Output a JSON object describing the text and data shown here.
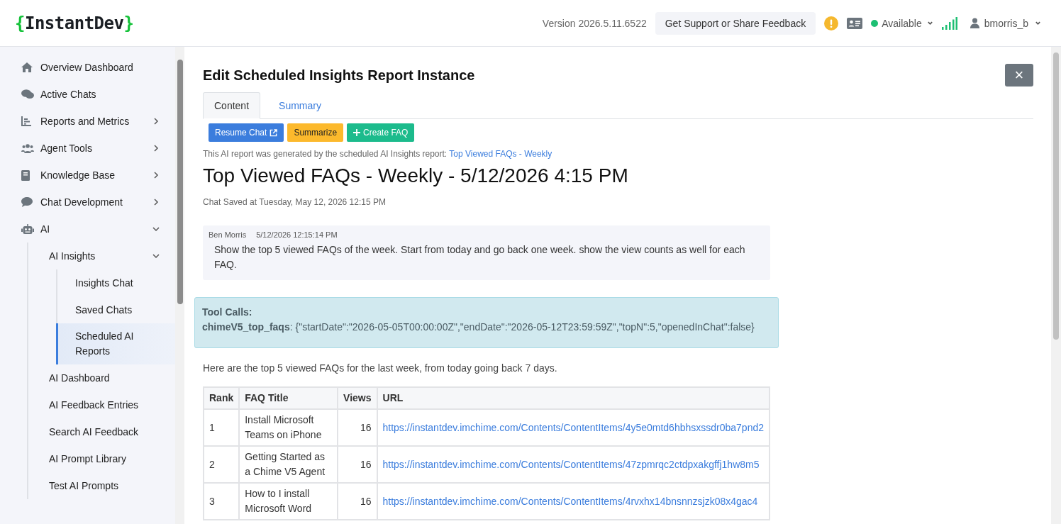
{
  "header": {
    "logo": {
      "open": "{",
      "name": "InstantDev",
      "close": "}"
    },
    "version": "Version 2026.5.11.6522",
    "support_button": "Get Support or Share Feedback",
    "status": "Available",
    "user": "bmorris_b"
  },
  "sidebar": {
    "items": [
      {
        "label": "Overview Dashboard",
        "selected": false
      },
      {
        "label": "Active Chats",
        "selected": false
      },
      {
        "label": "Reports and Metrics",
        "selected": false,
        "expanded": false
      },
      {
        "label": "Agent Tools",
        "selected": false,
        "expanded": false
      },
      {
        "label": "Knowledge Base",
        "selected": false,
        "expanded": false
      },
      {
        "label": "Chat Development",
        "selected": false,
        "expanded": false
      },
      {
        "label": "AI",
        "selected": false,
        "expanded": true,
        "children": [
          {
            "label": "AI Insights",
            "selected": false,
            "expanded": true,
            "children": [
              {
                "label": "Insights Chat",
                "selected": false
              },
              {
                "label": "Saved Chats",
                "selected": false
              },
              {
                "label": "Scheduled AI Reports",
                "selected": true
              }
            ]
          },
          {
            "label": "AI Dashboard",
            "selected": false
          },
          {
            "label": "AI Feedback Entries",
            "selected": false
          },
          {
            "label": "Search AI Feedback",
            "selected": false
          },
          {
            "label": "AI Prompt Library",
            "selected": false
          },
          {
            "label": "Test AI Prompts",
            "selected": false
          }
        ]
      }
    ]
  },
  "dialog": {
    "title": "Edit Scheduled Insights Report Instance",
    "close": "×",
    "tabs": [
      {
        "label": "Content",
        "selected": true
      },
      {
        "label": "Summary",
        "selected": false
      }
    ],
    "actions": [
      {
        "label": "Resume Chat",
        "kind": "primary"
      },
      {
        "label": "Summarize",
        "kind": "warning"
      },
      {
        "label": "Create FAQ",
        "kind": "success"
      }
    ],
    "source_note": {
      "text": "This AI report was generated by the scheduled AI Insights report:",
      "link": "Top Viewed FAQs - Weekly"
    },
    "report_title": "Top Viewed FAQs - Weekly - 5/12/2026 4:15 PM",
    "saved_at": "Chat Saved at Tuesday, May 12, 2026 12:15 PM",
    "message": {
      "author": "Ben Morris",
      "time": "5/12/2026 12:15:14 PM",
      "text": "Show the top 5 viewed FAQs of the week. Start from today and go back one week. show the view counts as well for each FAQ."
    },
    "tool_calls": {
      "heading": "Tool Calls:",
      "name": "chimeV5_top_faqs",
      "args": ": {\"startDate\":\"2026-05-05T00:00:00Z\",\"endDate\":\"2026-05-12T23:59:59Z\",\"topN\":5,\"openedInChat\":false}"
    },
    "answer_intro": "Here are the top 5 viewed FAQs for the last week, from today going back 7 days.",
    "table": {
      "columns": [
        "Rank",
        "FAQ Title",
        "Views",
        "URL"
      ],
      "rows": [
        [
          "1",
          "Install Microsoft Teams on iPhone",
          "16",
          "https://instantdev.imchime.com/Contents/ContentItems/4y5e0mtd6hbhsxssdr0ba7pnd2"
        ],
        [
          "2",
          "Getting Started as a Chime V5 Agent",
          "16",
          "https://instantdev.imchime.com/Contents/ContentItems/47zpmrqc2ctdpxakgffj1hw8m5"
        ],
        [
          "3",
          "How to I install Microsoft Word",
          "16",
          "https://instantdev.imchime.com/Contents/ContentItems/4rvxhx14bnsnnzsjzk08x4gac4"
        ]
      ]
    }
  }
}
